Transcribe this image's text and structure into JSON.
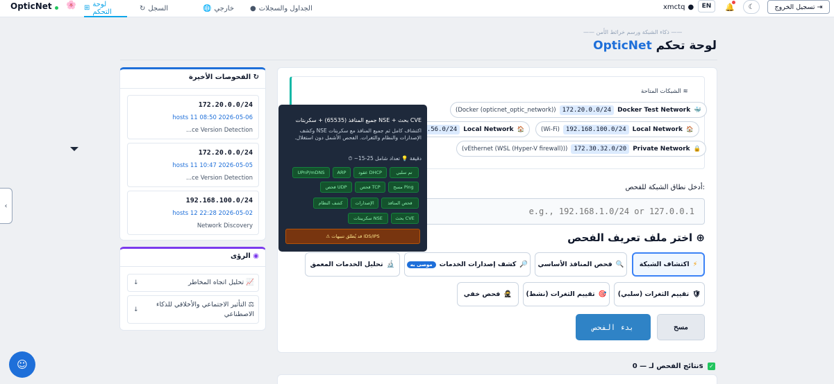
{
  "topbar": {
    "brand": "OpticNet",
    "logo_icon": "🌸",
    "nav": [
      {
        "label": "لوحة التحكم",
        "icon": "⊞",
        "active": true
      },
      {
        "label": "السجل",
        "icon": "↻"
      },
      {
        "label": "خارجي",
        "icon": "🌐"
      },
      {
        "label": "الجداول والسجلات",
        "icon": "●"
      }
    ],
    "user": "xmctq",
    "lang": "EN",
    "logout": "تسجيل الخروج"
  },
  "header": {
    "subtitle": "—— ذكاء الشبكة ورسم خرائط الأمن ——",
    "title_brand": "OpticNet",
    "title_rest": "لوحة تحكم"
  },
  "recent": {
    "title": "الفحوصات الأخيرة",
    "items": [
      {
        "ip": "172.20.0.0/24",
        "meta": "hosts 11  08:50 2026-05-06",
        "type": "...ce Version Detection"
      },
      {
        "ip": "172.20.0.0/24",
        "meta": "hosts 11  10:47 2026-05-05",
        "type": "...ce Version Detection"
      },
      {
        "ip": "192.168.100.0/24",
        "meta": "hosts 12  22:28 2026-05-02",
        "type": "Network Discovery"
      }
    ]
  },
  "insights": {
    "title": "الرؤى",
    "items": [
      {
        "label": "تحليل اتجاه المخاطر",
        "icon": "📈"
      },
      {
        "label": "التأثير الاجتماعي والأخلاقي للذكاء الاصطناعي",
        "icon": "⚖"
      }
    ]
  },
  "networks": {
    "title": "الشبكات المتاحة",
    "items": [
      {
        "name": "Docker Test Network",
        "cidr": "172.20.0.0/24",
        "desc": "(Docker (opticnet_optic_network))",
        "icon": "🐳"
      },
      {
        "name": "Local Network",
        "cidr": "192.168.100.0/24",
        "desc": "(Wi-Fi)",
        "icon": "🏠"
      },
      {
        "name": "Local Network",
        "cidr": "68.56.0/24",
        "desc": "",
        "icon": "🏠"
      },
      {
        "name": "Private Network",
        "cidr": "172.30.32.0/20",
        "desc": "(vEthernet (WSL (Hyper-V firewall)))",
        "icon": "🔒"
      }
    ]
  },
  "scan": {
    "range_label": "أدخل نطاق الشبكة للفحص:",
    "range_placeholder": "e.g., 192.168.1.0/24 or 127.0.0.1",
    "profile_title": "اختر ملف تعريف الفحص",
    "profiles": [
      {
        "label": "اكتشاف الشبكة",
        "icon": "⚡",
        "selected": true
      },
      {
        "label": "فحص المنافذ الأساسي",
        "icon": "🔍"
      },
      {
        "label": "كشف إصدارات الخدمات",
        "icon": "🔎",
        "badge": "موصى به"
      },
      {
        "label": "تحليل الخدمات المعمق",
        "icon": "🔬"
      },
      {
        "label": "تقييم الثغرات (سلبي)",
        "icon": "🛡"
      },
      {
        "label": "تقييم الثغرات (نشط)",
        "icon": "🎯"
      },
      {
        "label": "فحص خفي",
        "icon": "🥷"
      }
    ],
    "start": "بدء الفحص",
    "clear": "مسح",
    "results": "نتائج الفحص لـ — 0s"
  },
  "tooltip": {
    "title": "جميع المنافذ (65535) + سكربتات NSE + بحث CVE",
    "desc": "اكتشاف كامل ثم جميع المنافذ مع سكربتات NSE وكشف الإصدارات والنظام والثغرات. الفحص الأشمل دون استغلال.",
    "time": "⏱ ~15-25 دقيقة  💡 تعداد شامل",
    "chips": [
      "تم سلبي",
      "عقود DHCP",
      "ARP",
      "UPnP/mDNS",
      "مسح Ping",
      "فحص TCP",
      "فحص UDP",
      "فحص المنافذ",
      "الإصدارات",
      "كشف النظام",
      "بحث CVE",
      "سكريبتات NSE"
    ],
    "warning": "⚠ قد يُطلق تنبيهات IDS/IPS"
  }
}
